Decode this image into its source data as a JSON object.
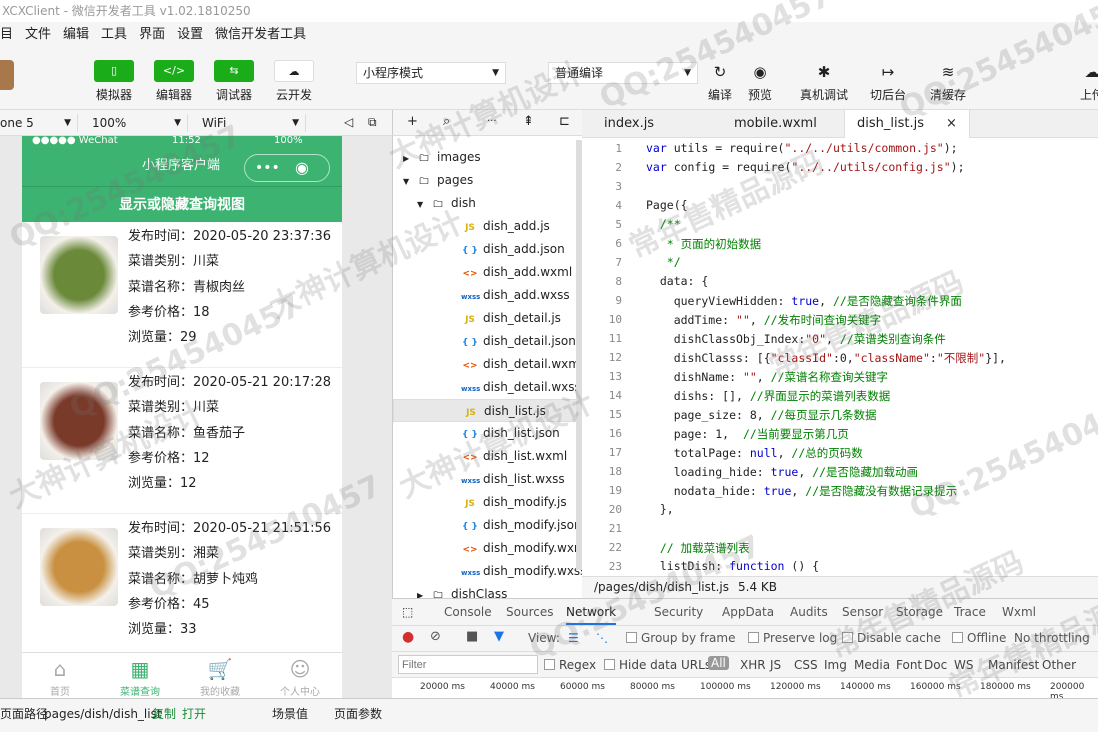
{
  "window": {
    "title": "XCXClient - 微信开发者工具 v1.02.1810250"
  },
  "menu": [
    "目",
    "文件",
    "编辑",
    "工具",
    "界面",
    "设置",
    "微信开发者工具"
  ],
  "toolbar": {
    "simulator": "模拟器",
    "editor": "编辑器",
    "debugger": "调试器",
    "cloud": "云开发",
    "mode_select": "小程序模式",
    "compile_select": "普通编译",
    "compile": "编译",
    "preview": "预览",
    "remote_debug": "真机调试",
    "background": "切后台",
    "clear_cache": "清缓存",
    "upload": "上传"
  },
  "sim_bar": {
    "device": "one 5",
    "zoom": "100%",
    "network": "WiFi"
  },
  "phone": {
    "status_left": "●●●●● WeChat",
    "status_time": "11:52",
    "status_right": "100%",
    "nav_title": "小程序客户端",
    "capsule_dots": "•••",
    "capsule_circle": "◉",
    "toggle_label": "显示或隐藏查询视图",
    "dishes": [
      {
        "time": "发布时间：2020-05-20 23:37:36",
        "category": "菜谱类别：川菜",
        "name": "菜谱名称：青椒肉丝",
        "price": "参考价格：18",
        "views": "浏览量：29",
        "img_color": "#6a8a3a"
      },
      {
        "time": "发布时间：2020-05-21 20:17:28",
        "category": "菜谱类别：川菜",
        "name": "菜谱名称：鱼香茄子",
        "price": "参考价格：12",
        "views": "浏览量：12",
        "img_color": "#7a3a2a"
      },
      {
        "time": "发布时间：2020-05-21 21:51:56",
        "category": "菜谱类别：湘菜",
        "name": "菜谱名称：胡萝卜炖鸡",
        "price": "参考价格：45",
        "views": "浏览量：33",
        "img_color": "#c89040"
      }
    ],
    "tabs": [
      {
        "icon": "⌂",
        "label": "首页"
      },
      {
        "icon": "▦",
        "label": "菜谱查询"
      },
      {
        "icon": "🛒",
        "label": "我的收藏"
      },
      {
        "icon": "☺",
        "label": "个人中心"
      }
    ]
  },
  "file_toolbar": {
    "add": "+",
    "search": "⌕",
    "more": "···",
    "collapse": "⇞",
    "split": "⊏"
  },
  "file_tree": [
    {
      "type": "folder",
      "name": "images",
      "arrow": "▶",
      "indent": 0
    },
    {
      "type": "folder",
      "name": "pages",
      "arrow": "▼",
      "indent": 0
    },
    {
      "type": "folder",
      "name": "dish",
      "arrow": "▼",
      "indent": 1
    },
    {
      "type": "js",
      "name": "dish_add.js",
      "indent": 2
    },
    {
      "type": "json",
      "name": "dish_add.json",
      "indent": 2
    },
    {
      "type": "wxml",
      "name": "dish_add.wxml",
      "indent": 2
    },
    {
      "type": "wxss",
      "name": "dish_add.wxss",
      "indent": 2
    },
    {
      "type": "js",
      "name": "dish_detail.js",
      "indent": 2
    },
    {
      "type": "json",
      "name": "dish_detail.json",
      "indent": 2
    },
    {
      "type": "wxml",
      "name": "dish_detail.wxml",
      "indent": 2
    },
    {
      "type": "wxss",
      "name": "dish_detail.wxss",
      "indent": 2
    },
    {
      "type": "js",
      "name": "dish_list.js",
      "indent": 2,
      "selected": true
    },
    {
      "type": "json",
      "name": "dish_list.json",
      "indent": 2
    },
    {
      "type": "wxml",
      "name": "dish_list.wxml",
      "indent": 2
    },
    {
      "type": "wxss",
      "name": "dish_list.wxss",
      "indent": 2
    },
    {
      "type": "js",
      "name": "dish_modify.js",
      "indent": 2
    },
    {
      "type": "json",
      "name": "dish_modify.json",
      "indent": 2
    },
    {
      "type": "wxml",
      "name": "dish_modify.wxml",
      "indent": 2
    },
    {
      "type": "wxss",
      "name": "dish_modify.wxss",
      "indent": 2
    },
    {
      "type": "folder",
      "name": "dishClass",
      "arrow": "▶",
      "indent": 1
    }
  ],
  "file_icons": {
    "folder": "🗀",
    "js": "JS",
    "json": "{ }",
    "wxml": "<>",
    "wxss": "wxss"
  },
  "editor_tabs": [
    {
      "label": "index.js",
      "active": false
    },
    {
      "label": "mobile.wxml",
      "active": false
    },
    {
      "label": "dish_list.js",
      "active": true,
      "close": "×"
    }
  ],
  "code_lines": [
    "var utils = require(\"../../utils/common.js\");",
    "var config = require(\"../../utils/config.js\");",
    "",
    "Page({",
    "  /**",
    "   * 页面的初始数据",
    "   */",
    "  data: {",
    "    queryViewHidden: true, //是否隐藏查询条件界面",
    "    addTime: \"\", //发布时间查询关键字",
    "    dishClassObj_Index:\"0\", //菜谱类别查询条件",
    "    dishClasss: [{\"classId\":0,\"className\":\"不限制\"}],",
    "    dishName: \"\", //菜谱名称查询关键字",
    "    dishs: [], //界面显示的菜谱列表数据",
    "    page_size: 8, //每页显示几条数据",
    "    page: 1,  //当前要显示第几页",
    "    totalPage: null, //总的页码数",
    "    loading_hide: true, //是否隐藏加载动画",
    "    nodata_hide: true, //是否隐藏没有数据记录提示",
    "  },",
    "",
    "  // 加载菜谱列表",
    "  listDish: function () {"
  ],
  "editor_status": {
    "path": "/pages/dish/dish_list.js",
    "size": "5.4 KB"
  },
  "devtools": {
    "tabs": [
      "Console",
      "Sources",
      "Network",
      "Security",
      "AppData",
      "Audits",
      "Sensor",
      "Storage",
      "Trace",
      "Wxml"
    ],
    "active_tab": "Network",
    "view_label": "View:",
    "group_by_frame": "Group by frame",
    "preserve_log": "Preserve log",
    "disable_cache": "Disable cache",
    "offline": "Offline",
    "throttling": "No throttling",
    "filter_placeholder": "Filter",
    "regex": "Regex",
    "hide_data_urls": "Hide data URLs",
    "types": [
      "All",
      "XHR",
      "JS",
      "CSS",
      "Img",
      "Media",
      "Font",
      "Doc",
      "WS",
      "Manifest",
      "Other"
    ],
    "timeline": [
      "20000 ms",
      "40000 ms",
      "60000 ms",
      "80000 ms",
      "100000 ms",
      "120000 ms",
      "140000 ms",
      "160000 ms",
      "180000 ms",
      "200000 ms"
    ]
  },
  "bottom": {
    "path_label": "页面路径",
    "path": "pages/dish/dish_list",
    "copy": "复制",
    "open": "打开",
    "scene": "场景值",
    "params": "页面参数"
  },
  "watermarks": [
    "QQ:254540457",
    "大神计算机设计",
    "常年售精品源码"
  ]
}
